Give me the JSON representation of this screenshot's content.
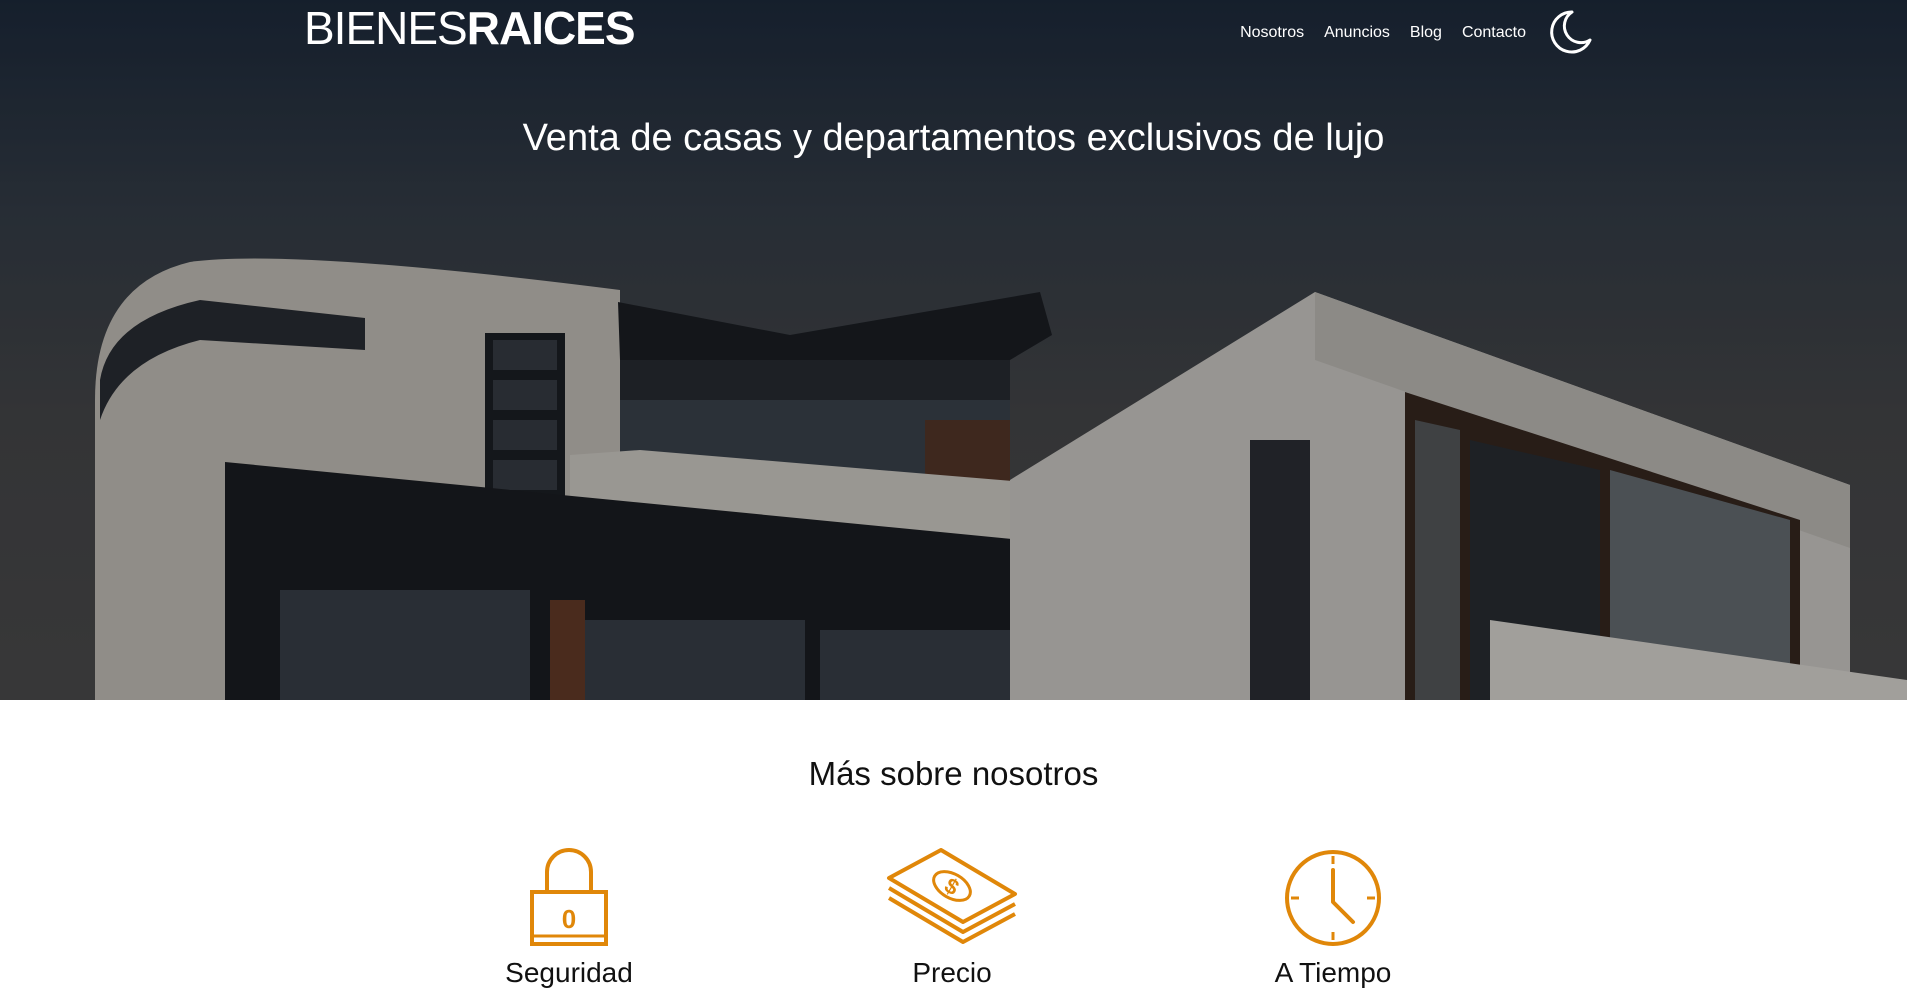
{
  "header": {
    "logo_light": "BIENES",
    "logo_bold": "RAICES",
    "nav": [
      "Nosotros",
      "Anuncios",
      "Blog",
      "Contacto"
    ],
    "dark_mode_icon": "moon-icon"
  },
  "hero": {
    "title": "Venta de casas y departamentos exclusivos de lujo"
  },
  "about": {
    "title": "Más sobre nosotros",
    "features": [
      {
        "icon": "lock-icon",
        "title": "Seguridad"
      },
      {
        "icon": "money-icon",
        "title": "Precio"
      },
      {
        "icon": "clock-icon",
        "title": "A Tiempo"
      }
    ]
  },
  "colors": {
    "accent": "#e08709",
    "text": "#111111",
    "white": "#ffffff"
  }
}
